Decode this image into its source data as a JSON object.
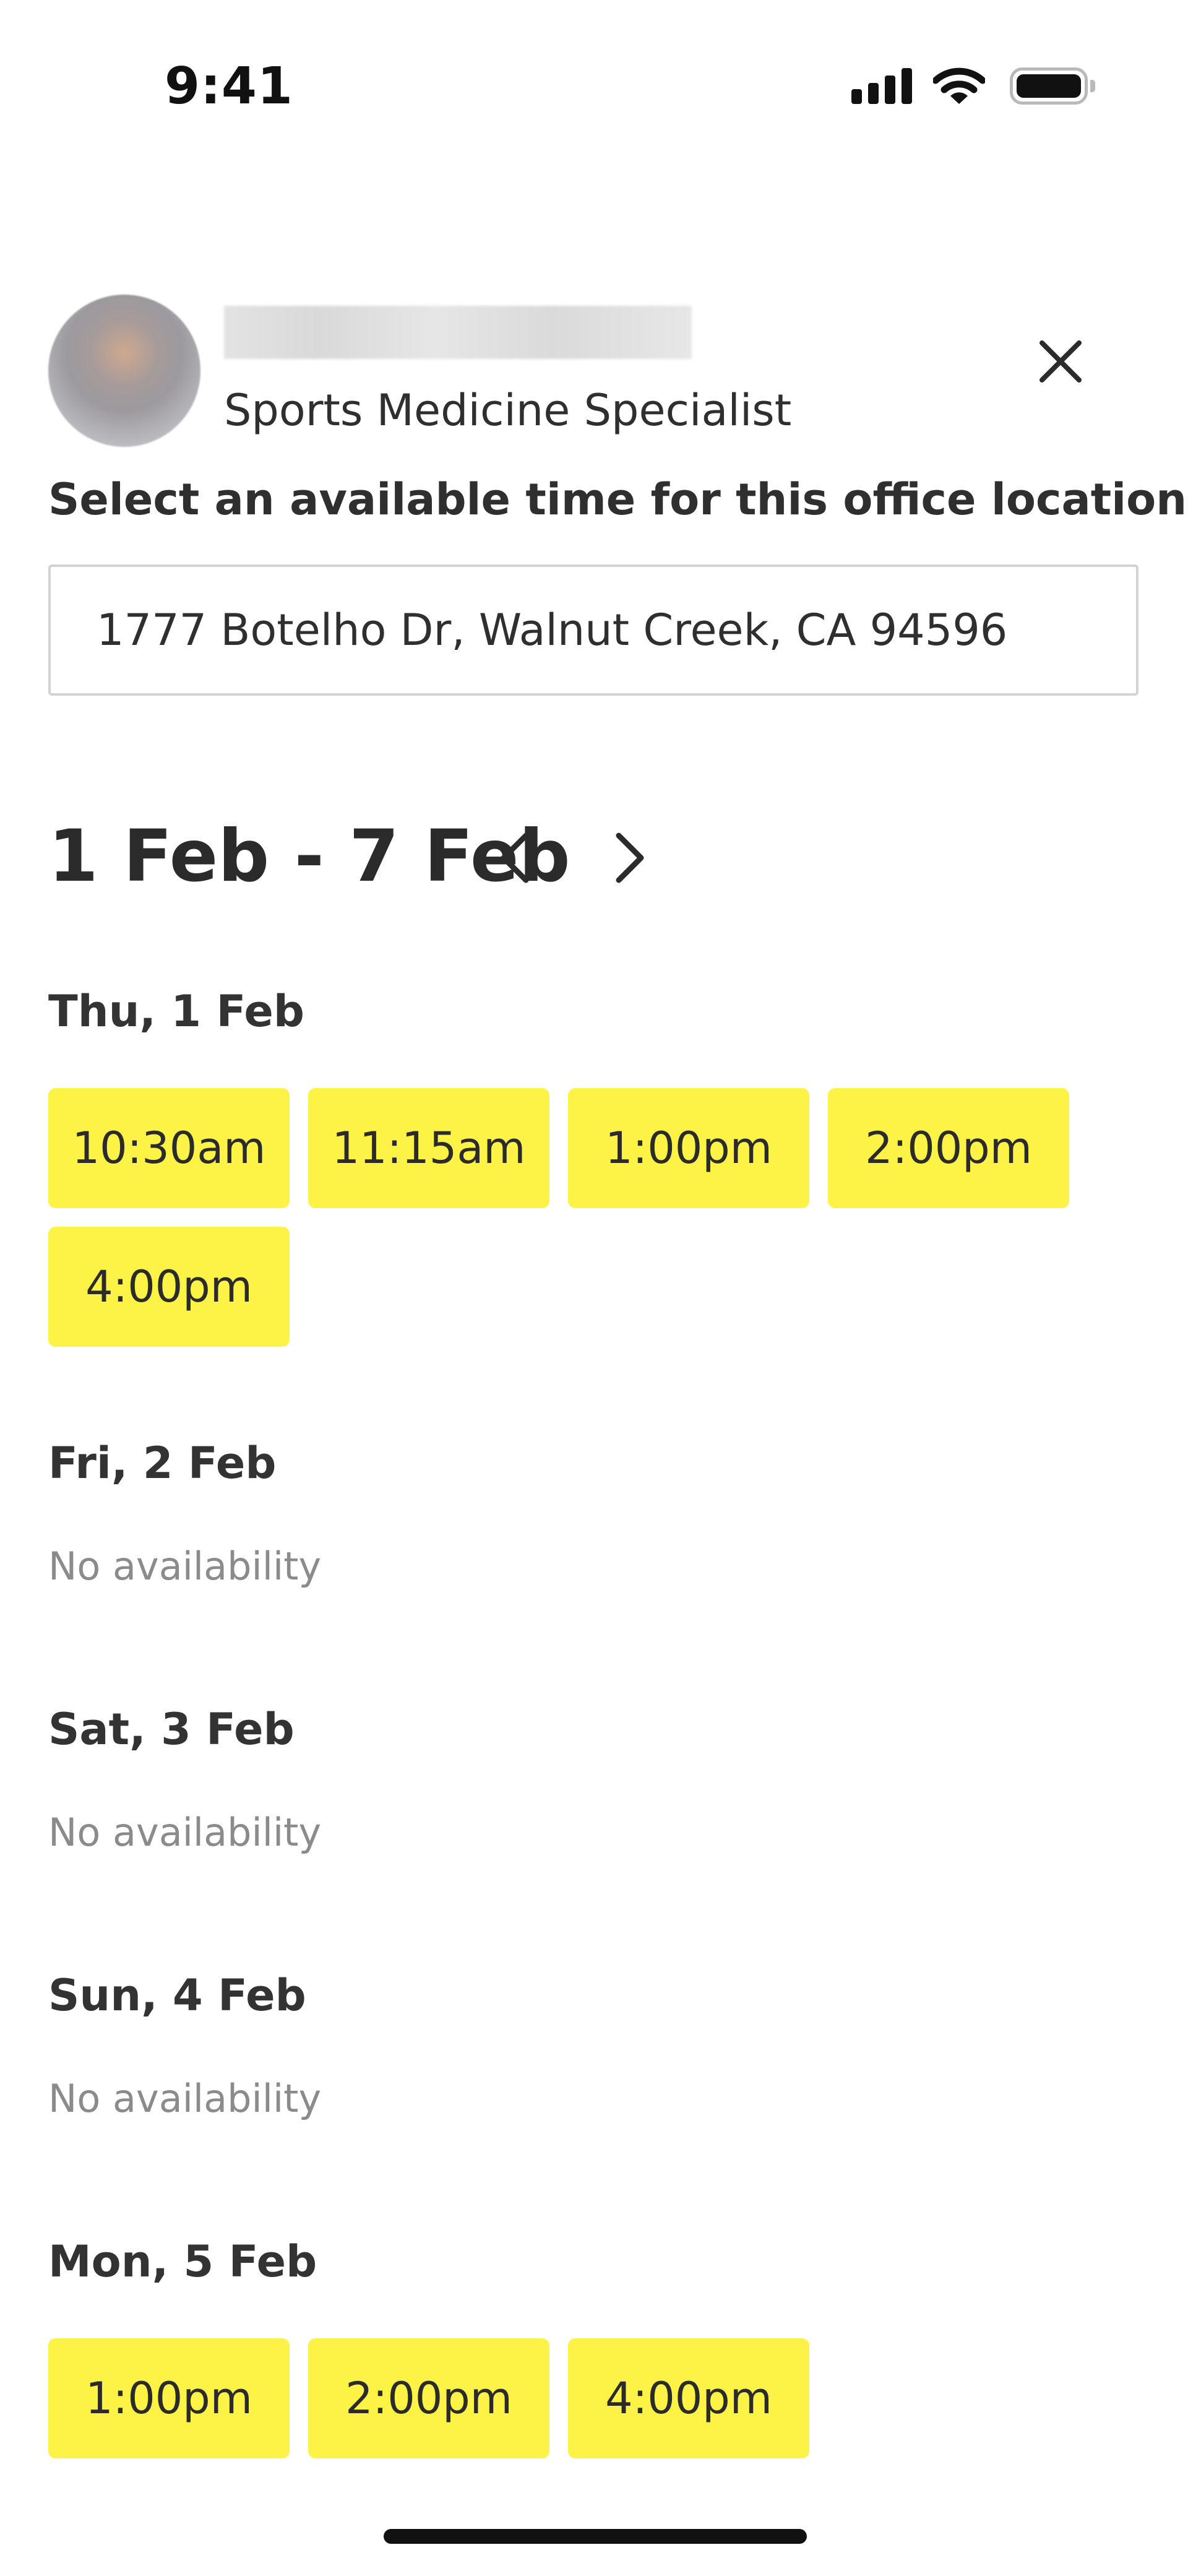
{
  "status_bar": {
    "time": "9:41",
    "icons": [
      "cellular-signal-icon",
      "wifi-icon",
      "battery-icon"
    ]
  },
  "provider": {
    "specialty": "Sports Medicine Specialist",
    "name_redacted": true
  },
  "instructions": "Select an available time for this office location",
  "location": "1777 Botelho Dr, Walnut Creek, CA 94596",
  "week": {
    "range": "1 Feb - 7 Feb",
    "prev_icon": "chevron-left-icon",
    "next_icon": "chevron-right-icon"
  },
  "days": [
    {
      "label": "Thu, 1 Feb",
      "slots": [
        "10:30am",
        "11:15am",
        "1:00pm",
        "2:00pm",
        "4:00pm"
      ]
    },
    {
      "label": "Fri, 2 Feb",
      "slots": [],
      "empty_text": "No availability"
    },
    {
      "label": "Sat, 3 Feb",
      "slots": [],
      "empty_text": "No availability"
    },
    {
      "label": "Sun, 4 Feb",
      "slots": [],
      "empty_text": "No availability"
    },
    {
      "label": "Mon, 5 Feb",
      "slots": [
        "1:00pm",
        "2:00pm",
        "4:00pm"
      ]
    }
  ],
  "colors": {
    "slot_background": "#fdf246",
    "text_primary": "#2b2b2b",
    "text_muted": "#8b8b8b",
    "border": "#d3d3d3"
  }
}
